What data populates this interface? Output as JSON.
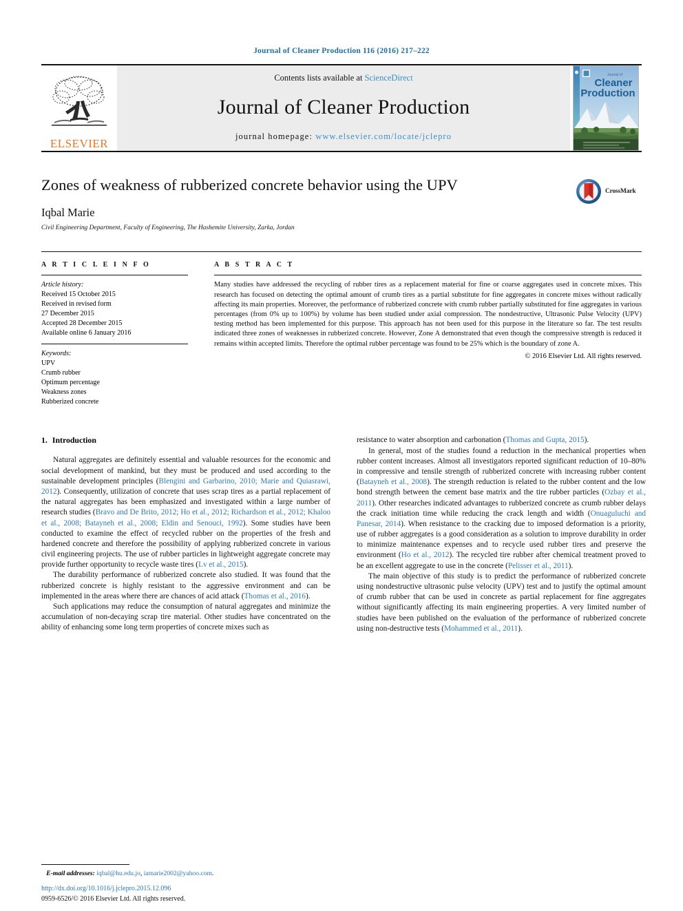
{
  "running_head": "Journal of Cleaner Production 116 (2016) 217–222",
  "masthead": {
    "contents_prefix": "Contents lists available at ",
    "sciencedirect": "ScienceDirect",
    "journal_name": "Journal of Cleaner Production",
    "homepage_prefix": "journal homepage: ",
    "homepage_url": "www.elsevier.com/locate/jclepro",
    "publisher": "ELSEVIER",
    "cover": {
      "line1": "Journal of",
      "line2": "Cleaner",
      "line3": "Production"
    },
    "accent_link_color": "#3a8fc4",
    "publisher_color": "#e87722"
  },
  "article": {
    "title": "Zones of weakness of rubberized concrete behavior using the UPV",
    "author": "Iqbal Marie",
    "affiliation": "Civil Engineering Department, Faculty of Engineering, The Hashemite University, Zarka, Jordan",
    "crossmark_label": "CrossMark"
  },
  "info": {
    "heading": "A R T I C L E   I N F O",
    "history_label": "Article history:",
    "history": [
      "Received 15 October 2015",
      "Received in revised form",
      "27 December 2015",
      "Accepted 28 December 2015",
      "Available online 6 January 2016"
    ],
    "keywords_label": "Keywords:",
    "keywords": [
      "UPV",
      "Crumb rubber",
      "Optimum percentage",
      "Weakness zones",
      "Rubberized concrete"
    ]
  },
  "abstract": {
    "heading": "A B S T R A C T",
    "text": "Many studies have addressed the recycling of rubber tires as a replacement material for fine or coarse aggregates used in concrete mixes. This research has focused on detecting the optimal amount of crumb tires as a partial substitute for fine aggregates in concrete mixes without radically affecting its main properties. Moreover, the performance of rubberized concrete with crumb rubber partially substituted for fine aggregates in various percentages (from 0% up to 100%) by volume has been studied under axial compression. The nondestructive, Ultrasonic Pulse Velocity (UPV) testing method has been implemented for this purpose. This approach has not been used for this purpose in the literature so far. The test results indicated three zones of weaknesses in rubberized concrete. However, Zone A demonstrated that even though the compressive strength is reduced it remains within accepted limits. Therefore the optimal rubber percentage was found to be 25% which is the boundary of zone A.",
    "copyright": "© 2016 Elsevier Ltd. All rights reserved."
  },
  "section": {
    "number": "1.",
    "title": "Introduction"
  },
  "left_column": {
    "p1_a": "Natural aggregates are definitely essential and valuable resources for the economic and social development of mankind, but they must be produced and used according to the sustainable development principles (",
    "p1_cite1": "Blengini and Garbarino, 2010; Marie and Quiasrawi, 2012",
    "p1_b": "). Consequently, utilization of concrete that uses scrap tires as a partial replacement of the natural aggregates has been emphasized and investigated within a large number of research studies (",
    "p1_cite2": "Bravo and De Brito, 2012; Ho et al., 2012; Richardson et al., 2012; Khaloo et al., 2008; Batayneh et al., 2008; Eldin and Senouci, 1992",
    "p1_c": "). Some studies have been conducted to examine the effect of recycled rubber on the properties of the fresh and hardened concrete and therefore the possibility of applying rubberized concrete in various civil engineering projects. The use of rubber particles in lightweight aggregate concrete may provide further opportunity to recycle waste tires (",
    "p1_cite3": "Lv et al., 2015",
    "p1_d": ").",
    "p2_a": "The durability performance of rubberized concrete also studied. It was found that the rubberized concrete is highly resistant to the aggressive environment and can be implemented in the areas where there are chances of acid attack (",
    "p2_cite1": "Thomas et al., 2016",
    "p2_b": ").",
    "p3": "Such applications may reduce the consumption of natural aggregates and minimize the accumulation of non-decaying scrap tire material. Other studies have concentrated on the ability of enhancing some long term properties of concrete mixes such as"
  },
  "right_column": {
    "p1_a": "resistance to water absorption and carbonation (",
    "p1_cite1": "Thomas and Gupta, 2015",
    "p1_b": ").",
    "p2_a": "In general, most of the studies found a reduction in the mechanical properties when rubber content increases. Almost all investigators reported significant reduction of 10–80% in compressive and tensile strength of rubberized concrete with increasing rubber content (",
    "p2_cite1": "Batayneh et al., 2008",
    "p2_b": "). The strength reduction is related to the rubber content and the low bond strength between the cement base matrix and the tire rubber particles (",
    "p2_cite2": "Ozbay et al., 2011",
    "p2_c": "). Other researches indicated advantages to rubberized concrete as crumb rubber delays the crack initiation time while reducing the crack length and width (",
    "p2_cite3": "Onuaguluchi and Panesar, 2014",
    "p2_d": "). When resistance to the cracking due to imposed deformation is a priority, use of rubber aggregates is a good consideration as a solution to improve durability in order to minimize maintenance expenses and to recycle used rubber tires and preserve the environment (",
    "p2_cite4": "Ho et al., 2012",
    "p2_e": "). The recycled tire rubber after chemical treatment proved to be an excellent aggregate to use in the concrete (",
    "p2_cite5": "Pelisser et al., 2011",
    "p2_f": ").",
    "p3_a": "The main objective of this study is to predict the performance of rubberized concrete using nondestructive ultrasonic pulse velocity (UPV) test and to justify the optimal amount of crumb rubber that can be used in concrete as partial replacement for fine aggregates without significantly affecting its main engineering properties. A very limited number of studies have been published on the evaluation of the performance of rubberized concrete using non-destructive tests (",
    "p3_cite1": "Mohammed et al., 2011",
    "p3_b": ")."
  },
  "footer": {
    "email_label": "E-mail addresses:",
    "email1": "iqbal@hu.edu.jo",
    "email_sep": ", ",
    "email2": "iamarie2002@yahoo.com",
    "email_end": ".",
    "doi": "http://dx.doi.org/10.1016/j.jclepro.2015.12.096",
    "issn": "0959-6526/© 2016 Elsevier Ltd. All rights reserved."
  }
}
